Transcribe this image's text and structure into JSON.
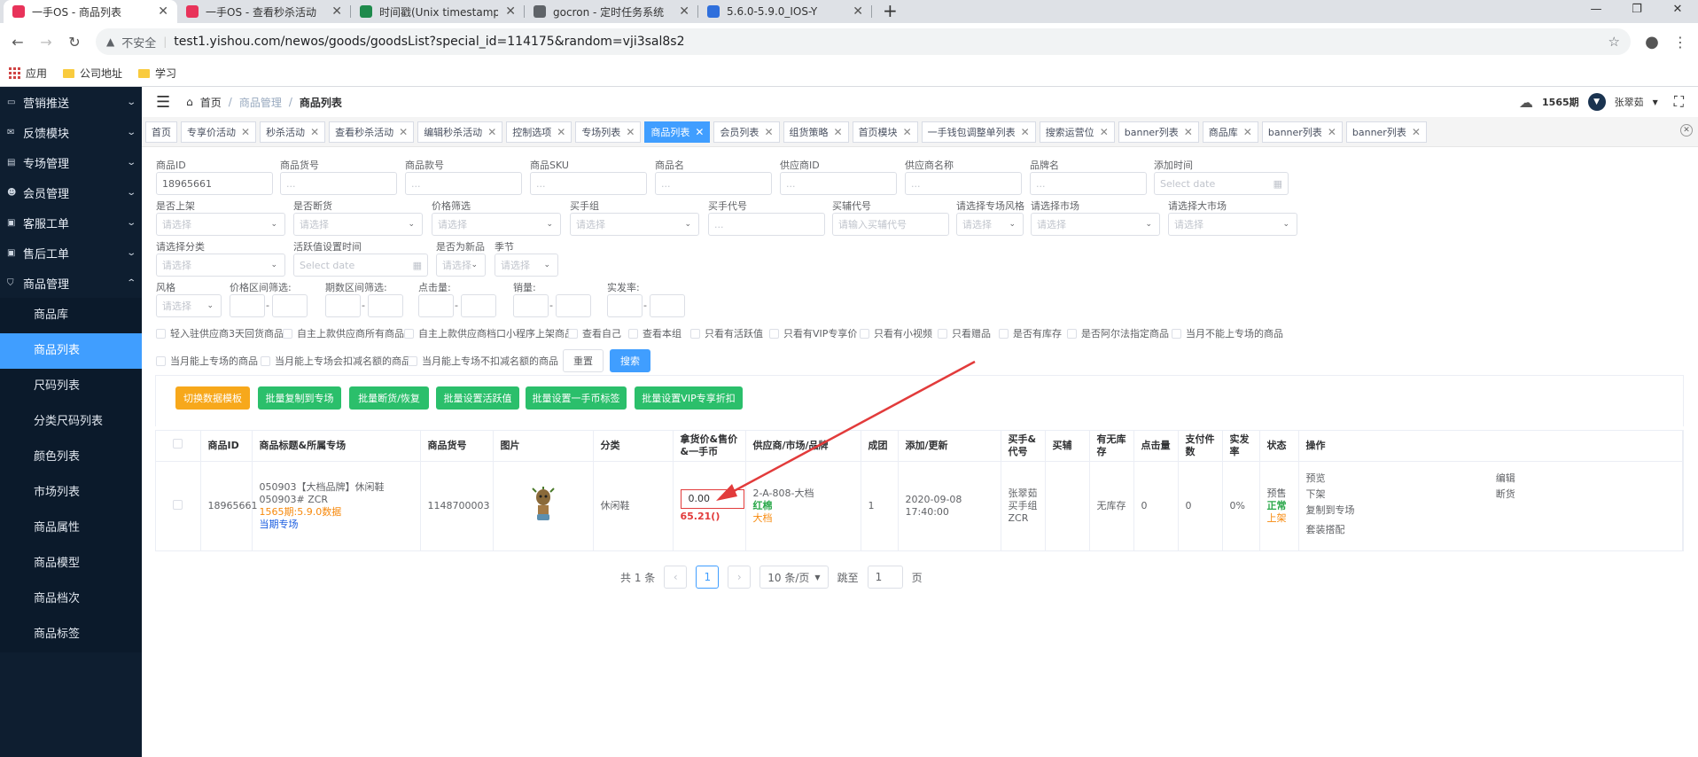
{
  "browser": {
    "tabs": [
      {
        "title": "一手OS - 商品列表",
        "active": true,
        "favicon_color": "#e8335a"
      },
      {
        "title": "一手OS - 查看秒杀活动",
        "active": false,
        "favicon_color": "#e8335a"
      },
      {
        "title": "时间戳(Unix timestamp)转换工具",
        "active": false,
        "favicon_color": "#1f8a4c"
      },
      {
        "title": "gocron - 定时任务系统",
        "active": false,
        "favicon_color": "#5f6368"
      },
      {
        "title": "5.6.0-5.9.0_IOS-Y",
        "active": false,
        "favicon_color": "#2f6fdc"
      }
    ],
    "new_tab": "+",
    "insecure_label": "不安全",
    "url": "test1.yishou.com/newos/goods/goodsList?special_id=114175&random=vji3sal8s2",
    "bookmarks": [
      {
        "label": "应用",
        "icon": "apps-grid-icon"
      },
      {
        "label": "公司地址",
        "icon": "folder-icon"
      },
      {
        "label": "学习",
        "icon": "folder-icon"
      }
    ]
  },
  "sidebar": {
    "groups": [
      {
        "label": "营销推送",
        "icon": "send-icon",
        "chevron": "⌄"
      },
      {
        "label": "反馈模块",
        "icon": "mail-icon",
        "chevron": "⌄"
      },
      {
        "label": "专场管理",
        "icon": "doc-icon",
        "chevron": "⌄"
      },
      {
        "label": "会员管理",
        "icon": "users-icon",
        "chevron": "⌄"
      },
      {
        "label": "客服工单",
        "icon": "ticket-icon",
        "chevron": "⌄"
      },
      {
        "label": "售后工单",
        "icon": "ticket-icon",
        "chevron": "⌄"
      }
    ],
    "open_group": {
      "label": "商品管理",
      "icon": "bag-icon",
      "chevron": "⌃"
    },
    "items": [
      "商品库",
      "商品列表",
      "尺码列表",
      "分类尺码列表",
      "颜色列表",
      "市场列表",
      "商品属性",
      "商品模型",
      "商品档次",
      "商品标签"
    ],
    "active_item": "商品列表"
  },
  "topnav": {
    "crumbs": [
      "首页",
      "商品管理",
      "商品列表"
    ],
    "period": "1565期",
    "user": "张翠茹"
  },
  "tags": [
    {
      "label": "首页",
      "active": false,
      "closable": false
    },
    {
      "label": "专享价活动",
      "active": false,
      "closable": true
    },
    {
      "label": "秒杀活动",
      "active": false,
      "closable": true
    },
    {
      "label": "查看秒杀活动",
      "active": false,
      "closable": true
    },
    {
      "label": "编辑秒杀活动",
      "active": false,
      "closable": true
    },
    {
      "label": "控制选项",
      "active": false,
      "closable": true
    },
    {
      "label": "专场列表",
      "active": false,
      "closable": true
    },
    {
      "label": "商品列表",
      "active": true,
      "closable": true
    },
    {
      "label": "会员列表",
      "active": false,
      "closable": true
    },
    {
      "label": "组货策略",
      "active": false,
      "closable": true
    },
    {
      "label": "首页模块",
      "active": false,
      "closable": true
    },
    {
      "label": "一手钱包调整单列表",
      "active": false,
      "closable": true
    },
    {
      "label": "搜索运营位",
      "active": false,
      "closable": true
    },
    {
      "label": "banner列表",
      "active": false,
      "closable": true
    },
    {
      "label": "商品库",
      "active": false,
      "closable": true
    },
    {
      "label": "banner列表",
      "active": false,
      "closable": true
    },
    {
      "label": "banner列表",
      "active": false,
      "closable": true
    }
  ],
  "filters": {
    "goods_id": {
      "label": "商品ID",
      "value": "18965661"
    },
    "goods_no": {
      "label": "商品货号",
      "placeholder": "..."
    },
    "style_no": {
      "label": "商品款号",
      "placeholder": "..."
    },
    "sku": {
      "label": "商品SKU",
      "placeholder": "..."
    },
    "goods_name": {
      "label": "商品名",
      "placeholder": "..."
    },
    "supplier_id": {
      "label": "供应商ID",
      "placeholder": "..."
    },
    "supplier_name": {
      "label": "供应商名称",
      "placeholder": "..."
    },
    "brand": {
      "label": "品牌名",
      "placeholder": "..."
    },
    "add_time": {
      "label": "添加时间",
      "placeholder": "Select date"
    },
    "on_shelf": {
      "label": "是否上架",
      "placeholder": "请选择"
    },
    "out_of_stock": {
      "label": "是否断货",
      "placeholder": "请选择"
    },
    "price_filter": {
      "label": "价格筛选",
      "placeholder": "请选择"
    },
    "buyer_group": {
      "label": "买手组",
      "placeholder": "请选择"
    },
    "buyer_code": {
      "label": "买手代号",
      "placeholder": "..."
    },
    "assist_code": {
      "label": "买辅代号",
      "placeholder": "请输入买辅代号"
    },
    "special_style": {
      "label": "请选择专场风格",
      "placeholder": "请选择"
    },
    "market": {
      "label": "请选择市场",
      "placeholder": "请选择"
    },
    "big_market": {
      "label": "请选择大市场",
      "placeholder": "请选择"
    },
    "category": {
      "label": "请选择分类",
      "placeholder": "请选择"
    },
    "active_time": {
      "label": "活跃值设置时间",
      "placeholder": "Select date"
    },
    "is_new": {
      "label": "是否为新品",
      "placeholder": "请选择"
    },
    "season": {
      "label": "季节",
      "placeholder": "请选择"
    },
    "style": {
      "label": "风格",
      "placeholder": "请选择"
    },
    "price_range": {
      "label": "价格区间筛选:"
    },
    "period_range": {
      "label": "期数区间筛选:"
    },
    "clicks": {
      "label": "点击量:"
    },
    "sales": {
      "label": "销量:"
    },
    "ship_rate": {
      "label": "实发率:"
    },
    "range_dash": "-",
    "checkboxes": [
      "轻入驻供应商3天回货商品",
      "自主上款供应商所有商品",
      "自主上款供应商档口小程序上架商品",
      "查看自己",
      "查看本组",
      "只看有活跃值",
      "只看有VIP专享价",
      "只看有小视频",
      "只看赠品",
      "是否有库存",
      "是否阿尔法指定商品",
      "当月不能上专场的商品",
      "当月能上专场的商品",
      "当月能上专场会扣减名额的商品",
      "当月能上专场不扣减名额的商品"
    ],
    "reset_label": "重置",
    "search_label": "搜索"
  },
  "actions": [
    "切换数据模板",
    "批量复制到专场",
    "批量断货/恢复",
    "批量设置活跃值",
    "批量设置一手币标签",
    "批量设置VIP专享折扣"
  ],
  "table": {
    "headers": [
      "",
      "商品ID",
      "商品标题&所属专场",
      "商品货号",
      "图片",
      "分类",
      "拿货价&售价&一手币",
      "供应商/市场/品牌",
      "成团",
      "添加/更新",
      "买手&代号",
      "买辅",
      "有无库存",
      "点击量",
      "支付件数",
      "实发率",
      "状态",
      "操作"
    ],
    "row": {
      "goods_id": "18965661",
      "title": "050903【大档品牌】休闲鞋 050903# ZCR",
      "period_tag": "1565期:5.9.0数据",
      "special": "当期专场",
      "goods_no": "1148700003",
      "category": "休闲鞋",
      "cost_price": "0.00",
      "sale_price": "65.21()",
      "supplier": "2-A-808-大档",
      "market": "红棉",
      "brand": "大档",
      "group": "1",
      "updated": "2020-09-08 17:40:00",
      "buyer": "张翠茹买手组ZCR",
      "assist": "",
      "stock": "无库存",
      "clicks": "0",
      "paid": "0",
      "ship_rate": "0%",
      "status": [
        "预售",
        "正常",
        "上架"
      ],
      "ops": [
        "预览",
        "编辑",
        "下架",
        "断货",
        "复制到专场",
        "",
        "套装搭配",
        ""
      ]
    }
  },
  "pagination": {
    "total": "共 1 条",
    "current": "1",
    "size": "10 条/页",
    "goto_label": "跳至",
    "goto_value": "1",
    "page_unit": "页"
  },
  "colors": {
    "primary": "#409eff",
    "sidebar": "#0e1e30",
    "green": "#2bbf6b",
    "orange": "#f7a81b",
    "annotation_red": "#e23b3b"
  }
}
